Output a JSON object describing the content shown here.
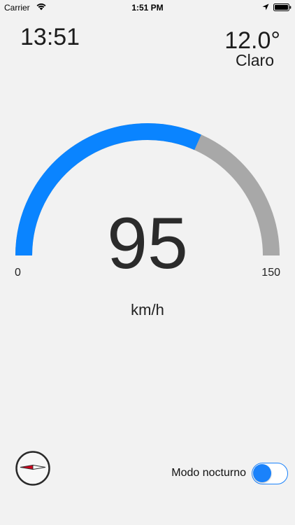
{
  "status_bar": {
    "carrier": "Carrier",
    "time": "1:51 PM",
    "icons": [
      "wifi-icon",
      "location-arrow-icon",
      "battery-icon"
    ]
  },
  "header": {
    "clock": "13:51",
    "temperature": "12.0°",
    "condition": "Claro"
  },
  "speedometer": {
    "speed": "95",
    "unit": "km/h",
    "min_label": "0",
    "max_label": "150",
    "min": 0,
    "max": 150,
    "value": 95,
    "fill_color": "#0a84ff",
    "track_color": "#a8a8a8"
  },
  "compass": {
    "icon": "compass-icon",
    "needle_color": "#d0021b"
  },
  "night_mode": {
    "label": "Modo nocturno",
    "enabled": true,
    "accent_color": "#1a82fb"
  }
}
